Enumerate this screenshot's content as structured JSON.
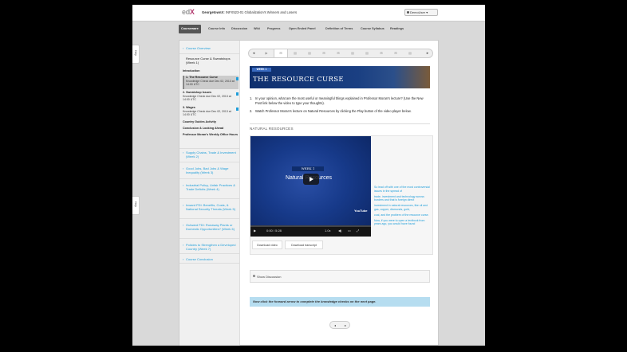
{
  "header": {
    "logo_prefix": "ed",
    "logo_x": "X",
    "school": "GeorgetownX:",
    "course": "INFX523-01 Globalization's Winners and Losers",
    "user": "DemoUser"
  },
  "nav": {
    "tabs": [
      {
        "label": "Courseware"
      },
      {
        "label": "Course Info"
      },
      {
        "label": "Discussion"
      },
      {
        "label": "Wiki"
      },
      {
        "label": "Progress"
      },
      {
        "label": "Open Ended Panel"
      },
      {
        "label": "Definition of Terms"
      },
      {
        "label": "Course Syllabus"
      },
      {
        "label": "Readings"
      }
    ]
  },
  "help_tabs": [
    "Help",
    "Help"
  ],
  "sidebar": {
    "overview": "Course Overview",
    "chapter1": {
      "title": "Resource Curse & Sweatshops (Week 1)",
      "intro": "Introduction",
      "items": [
        {
          "title": "1. The Resource Curse",
          "sub": "Knowledge Check due Dec 02, 2013 at 14:00 UTC"
        },
        {
          "title": "2. Sweatshop Issues",
          "sub": "Knowledge Check due Dec 02, 2013 at 14:00 UTC"
        },
        {
          "title": "3. Wages",
          "sub": "Knowledge Check due Dec 02, 2013 at 14:00 UTC"
        }
      ],
      "country": "Country Guides Activity",
      "conclusion": "Conclusion & Looking Ahead",
      "office": "Professor Moran's Weekly Office Hours"
    },
    "chapters": [
      "Supply Chains, Trade & Investment (Week 2)",
      "Good Jobs, Bad Jobs & Wage Inequality (Week 3)",
      "Industrial Policy, Unfair Practices & Trade Deficits (Week 4)",
      "Inward FDI: Benefits, Costs, & National Security Threats (Week 5)",
      "Outward FDI: Runaway Plants or Domestic Opportunities? (Week 6)",
      "Policies to Strengthen a Developed Country (Week 7)",
      "Course Conclusion"
    ]
  },
  "sequence": [
    "▶",
    "⊞",
    "▤",
    "▤",
    "⊞",
    "⊞",
    "▤",
    "▤",
    "⊞",
    "⊞",
    "▤"
  ],
  "banner": {
    "week": "WEEK 1",
    "title": "THE RESOURCE CURSE"
  },
  "questions": {
    "q1_num": "1.",
    "q1": "In your opinion, what are the most useful or meaningful things explained in Professor Moran's lecture? (Use the New Post link below the video to type your thoughts).",
    "q2_num": "2.",
    "q2": "Watch Professor Moran's lecture on Natural Resources by clicking the Play button of the video player below."
  },
  "video": {
    "section_title": "NATURAL RESOURCES",
    "week": "WEEK 1",
    "title": "Natural Resources",
    "time": "0:00 / 5:28",
    "speed": "1.0x",
    "yt": "YouTube",
    "transcript": [
      "So lead off with one of the most controversial issues in the spread of",
      "trade, investment and technology across borders and that is foreign direct",
      "investment in natural resources, like oil and gas, copper, diamonds, gold,",
      "coal, and the problem of the resource curse.",
      "Now, if you were to open a textbook from years ago, you would have found"
    ],
    "download_video": "Download video",
    "download_transcript": "Download transcript"
  },
  "discussion": {
    "label": "Show Discussion"
  },
  "note": "Now click the forward arrow to complete the knowledge checks on the next page."
}
